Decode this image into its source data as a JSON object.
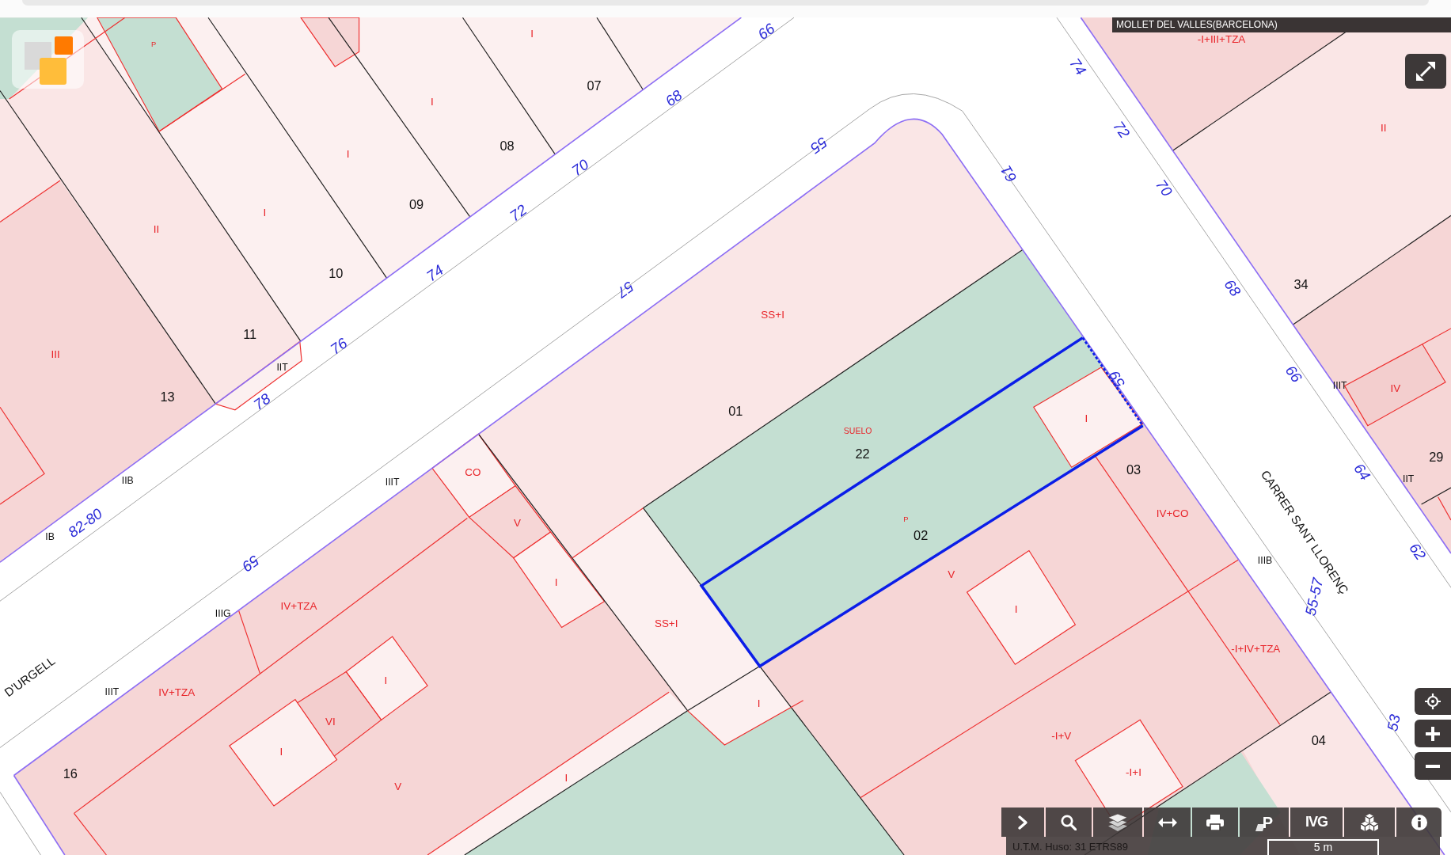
{
  "location_label": "MOLLET DEL VALLES(BARCELONA)",
  "map": {
    "parcel_numbers": [
      {
        "text": "07",
        "selected": false
      },
      {
        "text": "08",
        "selected": false
      },
      {
        "text": "09",
        "selected": false
      },
      {
        "text": "10",
        "selected": false
      },
      {
        "text": "34",
        "selected": false
      },
      {
        "text": "11",
        "selected": false
      },
      {
        "text": "13",
        "selected": false
      },
      {
        "text": "01",
        "selected": false
      },
      {
        "text": "22",
        "selected": false
      },
      {
        "text": "29",
        "selected": false
      },
      {
        "text": "03",
        "selected": false
      },
      {
        "text": "02",
        "selected": true
      },
      {
        "text": "04",
        "selected": false
      },
      {
        "text": "16",
        "selected": false
      }
    ],
    "building_labels": [
      "I",
      "-I+III+TZA",
      "P",
      "I",
      "II",
      "I",
      "I",
      "II",
      "SS+I",
      "III",
      "IV",
      "I",
      "SUELO",
      "CO",
      "IV+CO",
      "P",
      "V",
      "V",
      "I",
      "IV+TZA",
      "I",
      "SS+I",
      "-I+IV+TZA",
      "I",
      "IV+TZA",
      "I",
      "VI",
      "-I+V",
      "I",
      "-I+I",
      "I",
      "V"
    ],
    "facade_labels": [
      "IIT",
      "IIIT",
      "IIB",
      "IIT",
      "IIIT",
      "IB",
      "IIIB",
      "IIIG",
      "IIIT"
    ],
    "street_numbers": [
      "66",
      "74",
      "68",
      "72",
      "55",
      "70",
      "61",
      "70",
      "72",
      "74",
      "68",
      "57",
      "76",
      "66",
      "59",
      "78",
      "64",
      "82-80",
      "62",
      "59",
      "55-57",
      "53"
    ],
    "street_names": [
      "CARRER SANT LLORENÇ",
      "D'URGELL"
    ]
  },
  "toolbar": {
    "buttons": [
      {
        "kind": "icon"
      },
      {
        "kind": "icon"
      },
      {
        "kind": "icon"
      },
      {
        "kind": "icon"
      },
      {
        "kind": "icon"
      },
      {
        "kind": "letter",
        "label": "P"
      },
      {
        "kind": "text",
        "label": "IVG"
      },
      {
        "kind": "icon"
      },
      {
        "kind": "icon"
      }
    ]
  },
  "status_bar": {
    "projection": "U.T.M. Huso: 31 ETRS89",
    "scale": "5 m"
  }
}
